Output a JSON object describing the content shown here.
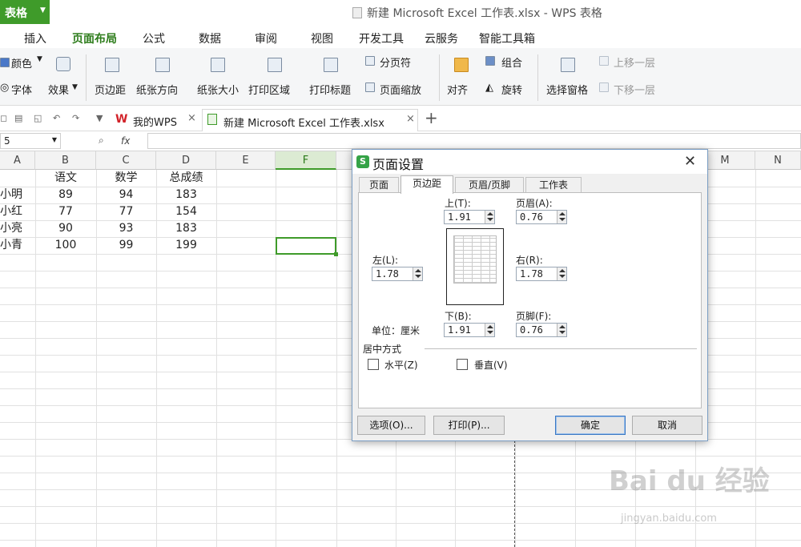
{
  "app": {
    "name": "表格",
    "window_title": "新建 Microsoft Excel 工作表.xlsx - WPS 表格"
  },
  "menu": [
    "插入",
    "页面布局",
    "公式",
    "数据",
    "审阅",
    "视图",
    "开发工具",
    "云服务",
    "智能工具箱"
  ],
  "ribbon": {
    "color": "颜色",
    "font": "字体",
    "effect": "效果",
    "margins": "页边距",
    "orientation": "纸张方向",
    "size": "纸张大小",
    "print_area": "打印区域",
    "print_titles": "打印标题",
    "page_break": "分页符",
    "page_zoom": "页面缩放",
    "align": "对齐",
    "group": "组合",
    "rotate": "旋转",
    "selection_pane": "选择窗格",
    "bring_forward": "上移一层",
    "send_backward": "下移一层"
  },
  "tabs": {
    "wps": "我的WPS",
    "doc": "新建 Microsoft Excel 工作表.xlsx"
  },
  "formula_bar": {
    "name_box": "5",
    "fx": "fx"
  },
  "sheet": {
    "columns": [
      "A",
      "B",
      "C",
      "D",
      "E",
      "F",
      "M",
      "N"
    ],
    "header_row": [
      "",
      "语文",
      "数学",
      "总成绩"
    ],
    "rows": [
      [
        "小明",
        "89",
        "94",
        "183"
      ],
      [
        "小红",
        "77",
        "77",
        "154"
      ],
      [
        "小亮",
        "90",
        "93",
        "183"
      ],
      [
        "小青",
        "100",
        "99",
        "199"
      ]
    ]
  },
  "dialog": {
    "title": "页面设置",
    "tabs": [
      "页面",
      "页边距",
      "页眉/页脚",
      "工作表"
    ],
    "top_label": "上(T):",
    "top": "1.91",
    "header_label": "页眉(A):",
    "header": "0.76",
    "left_label": "左(L):",
    "left": "1.78",
    "right_label": "右(R):",
    "right": "1.78",
    "bottom_label": "下(B):",
    "bottom": "1.91",
    "footer_label": "页脚(F):",
    "footer": "0.76",
    "unit": "单位：厘米",
    "center_title": "居中方式",
    "horizontal": "水平(Z)",
    "vertical": "垂直(V)",
    "options": "选项(O)...",
    "print": "打印(P)...",
    "ok": "确定",
    "cancel": "取消"
  },
  "watermark": {
    "logo": "Bai du 经验",
    "url": "jingyan.baidu.com"
  }
}
